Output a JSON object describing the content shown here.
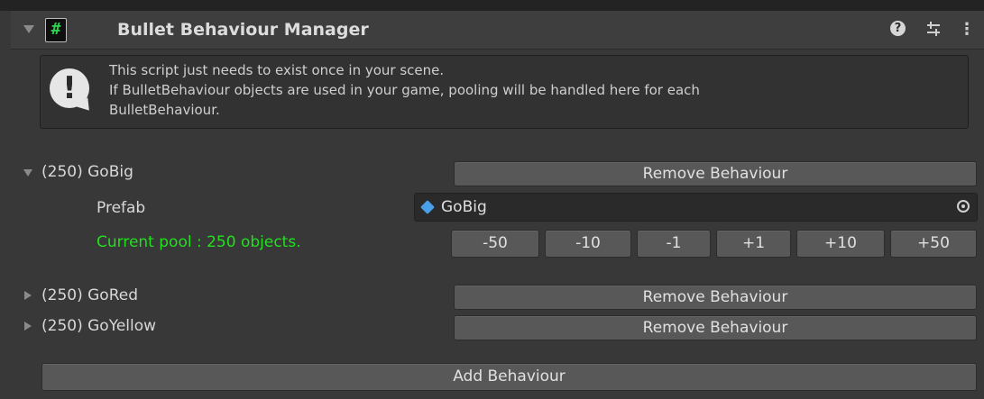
{
  "header": {
    "title": "Bullet Behaviour Manager",
    "script_icon": "#",
    "help_icon": "?",
    "settings_icon": "sliders-icon",
    "menu_icon": "⋮"
  },
  "info": {
    "icon": "!",
    "lines": [
      "This script just needs to exist once in your scene.",
      "If BulletBehaviour objects are used in your game, pooling will be handled here for each",
      "BulletBehaviour."
    ]
  },
  "behaviours": [
    {
      "label": "(250) GoBig",
      "remove_label": "Remove Behaviour",
      "prefab_label": "Prefab",
      "prefab_value": "GoBig",
      "pool_text": "Current pool : 250 objects.",
      "buttons": [
        "-50",
        "-10",
        "-1",
        "+1",
        "+10",
        "+50"
      ]
    },
    {
      "label": "(250) GoRed",
      "remove_label": "Remove Behaviour"
    },
    {
      "label": "(250) GoYellow",
      "remove_label": "Remove Behaviour"
    }
  ],
  "add_label": "Add Behaviour",
  "colors": {
    "pool_text": "#22e01e",
    "background": "#383838"
  }
}
